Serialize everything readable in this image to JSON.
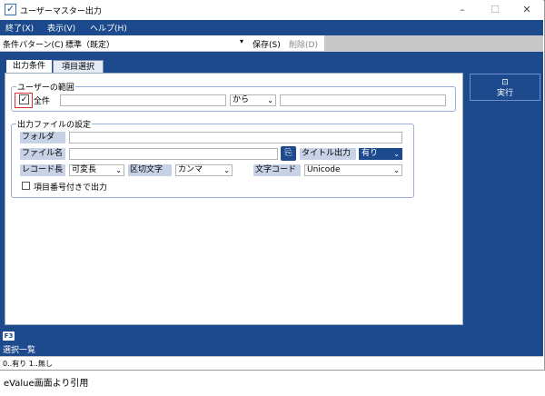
{
  "window": {
    "title": "ユーザーマスター出力",
    "icon": "check-v-icon"
  },
  "menu": {
    "items": [
      "終了(X)",
      "表示(V)",
      "ヘルプ(H)"
    ]
  },
  "condition_bar": {
    "label": "条件パターン(C)",
    "value": "標準（既定）",
    "save": "保存(S)",
    "delete": "削除(D)"
  },
  "tabs": [
    "出力条件",
    "項目選択"
  ],
  "user_range": {
    "legend": "ユーザーの範囲",
    "all_label": "全件",
    "all_checked": true,
    "separator": "から"
  },
  "output_file": {
    "legend": "出力ファイルの設定",
    "folder_label": "フォルダ",
    "filename_label": "ファイル名",
    "title_output_label": "タイトル出力",
    "title_output_value": "有り",
    "record_len_label": "レコード長",
    "record_len_value": "可変長",
    "delimiter_label": "区切文字",
    "delimiter_value": "カンマ",
    "charcode_label": "文字コード",
    "charcode_value": "Unicode",
    "item_number_label": "項目番号付きで出力",
    "item_number_checked": false
  },
  "execute_button": {
    "label": "実行",
    "icon": "play-icon"
  },
  "fkey": {
    "key": "F3",
    "label": "選択一覧"
  },
  "status": {
    "text": "0..有り 1..無し"
  },
  "caption": "eValue画面より引用",
  "colors": {
    "accent": "#1c4a8c",
    "label_bg": "#c7d2e6",
    "highlight_box": "#e03030"
  }
}
